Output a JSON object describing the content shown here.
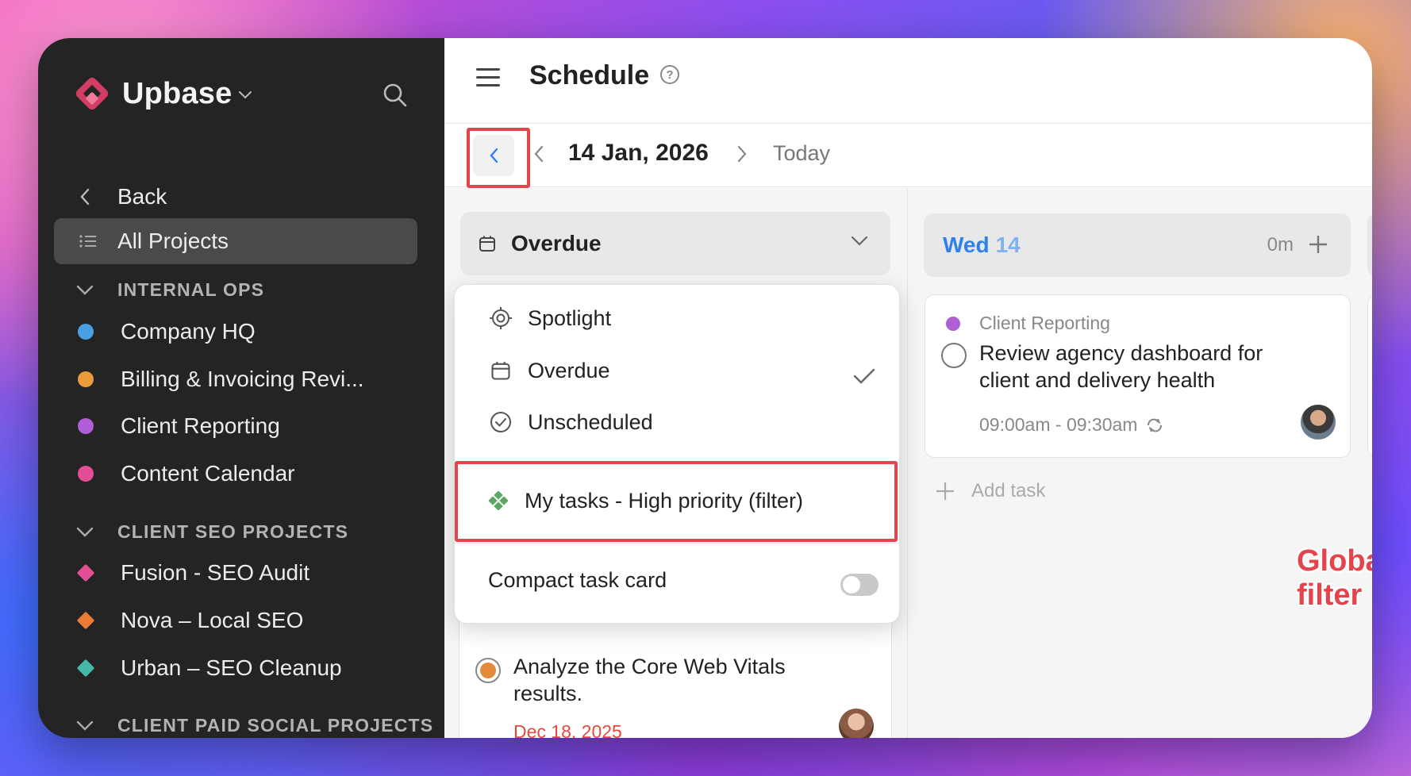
{
  "sidebar": {
    "brand": "Upbase",
    "back_label": "Back",
    "all_projects_label": "All Projects",
    "sections": [
      {
        "title": "INTERNAL OPS",
        "projects": [
          {
            "name": "Company HQ",
            "color": "#4a9fe0",
            "shape": "dot"
          },
          {
            "name": "Billing & Invoicing Revi...",
            "color": "#ec9a3a",
            "shape": "dot"
          },
          {
            "name": "Client Reporting",
            "color": "#b05fd6",
            "shape": "dot"
          },
          {
            "name": "Content Calendar",
            "color": "#e24f94",
            "shape": "dot"
          }
        ]
      },
      {
        "title": "CLIENT SEO PROJECTS",
        "projects": [
          {
            "name": "Fusion - SEO Audit",
            "color": "#e24f94",
            "shape": "diamond"
          },
          {
            "name": "Nova – Local SEO",
            "color": "#ee7b33",
            "shape": "diamond"
          },
          {
            "name": "Urban – SEO Cleanup",
            "color": "#45b8a8",
            "shape": "diamond"
          }
        ]
      },
      {
        "title": "CLIENT PAID SOCIAL PROJECTS",
        "projects": []
      }
    ]
  },
  "header": {
    "title": "Schedule",
    "help": "?"
  },
  "datebar": {
    "date": "14 Jan, 2026",
    "today": "Today"
  },
  "overdue_column": {
    "title": "Overdue",
    "card": {
      "title": "Analyze the Core Web Vitals results.",
      "due": "Dec 18, 2025"
    }
  },
  "wed_column": {
    "day": "Wed",
    "num": "14",
    "duration": "0m",
    "card": {
      "project": "Client Reporting",
      "title": "Review agency dashboard for client and delivery health",
      "time": "09:00am - 09:30am"
    },
    "add_task": "Add task"
  },
  "dropdown": {
    "items": [
      {
        "label": "Spotlight",
        "icon": "target-icon"
      },
      {
        "label": "Overdue",
        "icon": "calendar-icon",
        "selected": true
      },
      {
        "label": "Unscheduled",
        "icon": "check-circle-icon"
      }
    ],
    "filter_label": "My tasks - High priority (filter)",
    "compact_label": "Compact task card",
    "compact_on": false
  },
  "annotation": "Global filter",
  "colors": {
    "accent_blue": "#2f80ed",
    "highlight_red": "#e2454c",
    "overdue_red": "#e5483d",
    "sidebar_bg": "#242424"
  }
}
